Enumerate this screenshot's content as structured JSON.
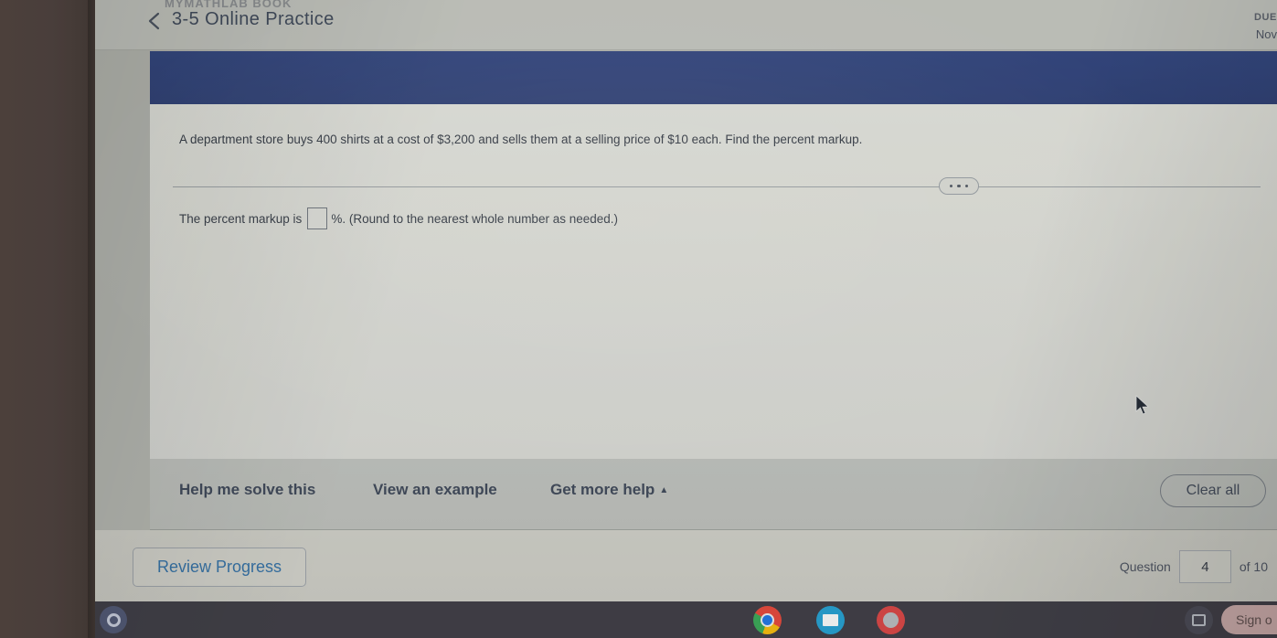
{
  "topbar": {
    "breadcrumb_ghost": "MYMATHLAB BOOK",
    "back_icon": "chevron-left-icon",
    "assignment_title": "3-5 Online Practice",
    "due_label": "DUE",
    "due_date": "Nov"
  },
  "question": {
    "prompt": "A department store buys 400 shirts at a cost of $3,200 and sells them at a selling price of $10 each. Find the percent markup.",
    "answer_prefix": "The percent markup is",
    "answer_value": "",
    "answer_suffix": "%. (Round to the nearest whole number as needed.)",
    "more_options_icon": "ellipsis-icon"
  },
  "actions": {
    "help_me_solve_this": "Help me solve this",
    "view_an_example": "View an example",
    "get_more_help": "Get more help",
    "get_more_help_caret": "▲",
    "clear_all": "Clear all"
  },
  "footer": {
    "review_progress": "Review Progress",
    "question_label": "Question",
    "question_number": "4",
    "of_label": "of 10"
  },
  "shelf": {
    "launcher_icon": "launcher-circle-icon",
    "apps": [
      {
        "name": "chrome-icon"
      },
      {
        "name": "news-app-icon"
      },
      {
        "name": "paint-app-icon"
      }
    ],
    "cast_icon": "screen-cast-icon",
    "sign_out_label": "Sign o"
  },
  "colors": {
    "navy_banner": "#2c407f",
    "link_blue": "#2f6fa8",
    "text_dark": "#2e3440"
  }
}
